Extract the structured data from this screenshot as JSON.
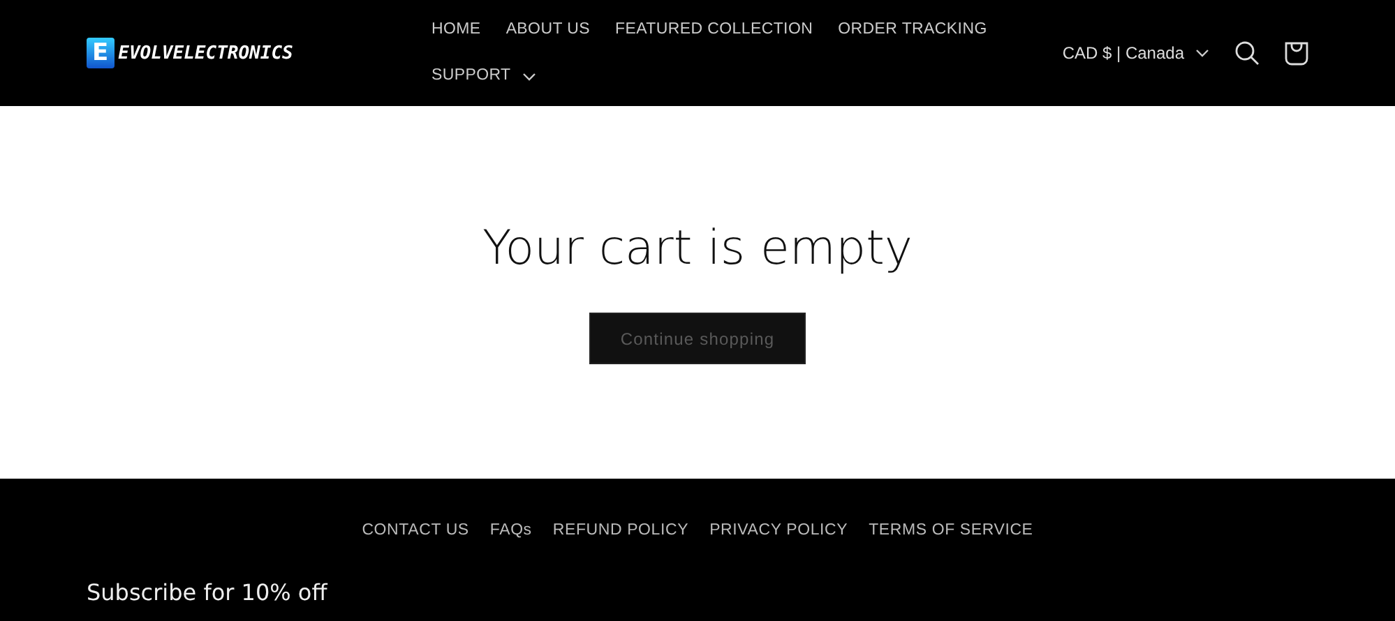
{
  "header": {
    "logo": {
      "mark": "E",
      "text": "EVOLVELECTRONICS"
    },
    "nav": [
      {
        "label": "HOME",
        "dropdown": false
      },
      {
        "label": "ABOUT US",
        "dropdown": false
      },
      {
        "label": "FEATURED COLLECTION",
        "dropdown": false
      },
      {
        "label": "ORDER TRACKING",
        "dropdown": false
      },
      {
        "label": "SUPPORT",
        "dropdown": true
      }
    ],
    "currency": "CAD $ | Canada"
  },
  "cart": {
    "title": "Your cart is empty",
    "button": "Continue shopping"
  },
  "footer": {
    "links": [
      "CONTACT US",
      "FAQs",
      "REFUND POLICY",
      "PRIVACY POLICY",
      "TERMS OF SERVICE"
    ],
    "subscribe": "Subscribe for 10% off"
  }
}
